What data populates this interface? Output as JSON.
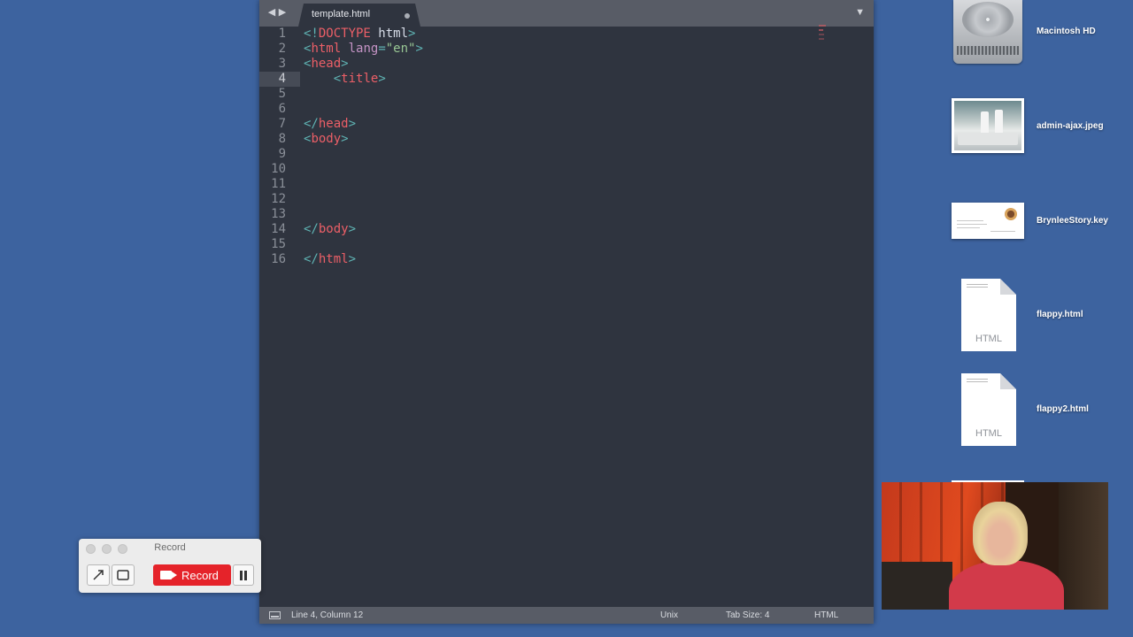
{
  "editor": {
    "tab_title": "template.html",
    "nav_back_icon": "◀",
    "nav_forward_icon": "▶",
    "tab_menu_icon": "▼",
    "line_numbers": [
      "1",
      "2",
      "3",
      "4",
      "5",
      "6",
      "7",
      "8",
      "9",
      "10",
      "11",
      "12",
      "13",
      "14",
      "15",
      "16"
    ],
    "current_line": 4,
    "code_lines": [
      "<!DOCTYPE html>",
      "<html lang=\"en\">",
      "<head>",
      "    <title>",
      "",
      "",
      "</head>",
      "<body>",
      "",
      "",
      "",
      "",
      "",
      "</body>",
      "",
      "</html>"
    ],
    "status": {
      "position": "Line 4, Column 12",
      "line_endings": "Unix",
      "tab_size": "Tab Size: 4",
      "syntax": "HTML"
    }
  },
  "desktop": {
    "icons": [
      {
        "label": "Macintosh HD",
        "kind": "hard-drive"
      },
      {
        "label": "admin-ajax.jpeg",
        "kind": "image"
      },
      {
        "label": "BrynleeStory.key",
        "kind": "keynote"
      },
      {
        "label": "flappy.html",
        "kind": "html",
        "type_label": "HTML"
      },
      {
        "label": "flappy2.html",
        "kind": "html",
        "type_label": "HTML"
      }
    ]
  },
  "recorder": {
    "title": "Record",
    "record_label": "Record"
  },
  "colors": {
    "desktop": "#3d639f",
    "editor_bg": "#2f343f",
    "record_red": "#e5232a"
  }
}
